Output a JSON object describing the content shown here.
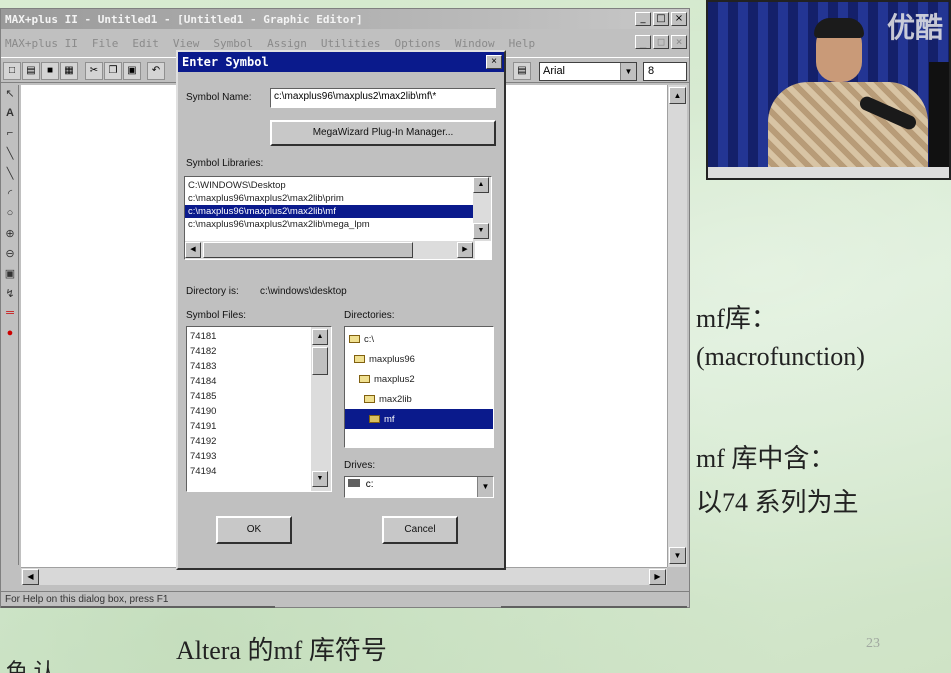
{
  "app": {
    "title": "MAX+plus II - Untitled1 - [Untitled1 - Graphic Editor]",
    "menu": [
      "MAX+plus II",
      "File",
      "Edit",
      "View",
      "Symbol",
      "Assign",
      "Utilities",
      "Options",
      "Window",
      "Help"
    ],
    "font_name": "Arial",
    "font_size": "8",
    "status_text": "For Help on this dialog box, press F1"
  },
  "dialog": {
    "title": "Enter Symbol",
    "symbol_name_label": "Symbol Name:",
    "symbol_name_value": "c:\\maxplus96\\maxplus2\\max2lib\\mf\\*",
    "megawizard_button": "MegaWizard Plug-In Manager...",
    "symbol_libraries_label": "Symbol Libraries:",
    "libraries": [
      {
        "text": "C:\\WINDOWS\\Desktop",
        "selected": false
      },
      {
        "text": "c:\\maxplus96\\maxplus2\\max2lib\\prim",
        "selected": false
      },
      {
        "text": "c:\\maxplus96\\maxplus2\\max2lib\\mf",
        "selected": true
      },
      {
        "text": "c:\\maxplus96\\maxplus2\\max2lib\\mega_lpm",
        "selected": false
      }
    ],
    "directory_is_label": "Directory is:",
    "directory_is_value": "c:\\windows\\desktop",
    "symbol_files_label": "Symbol Files:",
    "symbol_files": [
      "74181",
      "74182",
      "74183",
      "74184",
      "74185",
      "74190",
      "74191",
      "74192",
      "74193",
      "74194"
    ],
    "directories_label": "Directories:",
    "directories": [
      {
        "text": "c:\\",
        "selected": false
      },
      {
        "text": "maxplus96",
        "selected": false
      },
      {
        "text": "maxplus2",
        "selected": false
      },
      {
        "text": "max2lib",
        "selected": false
      },
      {
        "text": "mf",
        "selected": true
      }
    ],
    "drives_label": "Drives:",
    "drive_value": "c:",
    "ok_button": "OK",
    "cancel_button": "Cancel"
  },
  "video": {
    "watermark": "优酷"
  },
  "slide": {
    "line1": "mf库：",
    "line2": "(macrofunction)",
    "line3": "mf 库中含：",
    "line4": "以74 系列为主",
    "caption": "Altera 的mf 库符号",
    "page_number": "23",
    "corner_text": "色 认"
  },
  "colors": {
    "title_blue": "#0a1a8c",
    "window_gray": "#c0c0c0",
    "slide_green": "#d4eacd"
  }
}
